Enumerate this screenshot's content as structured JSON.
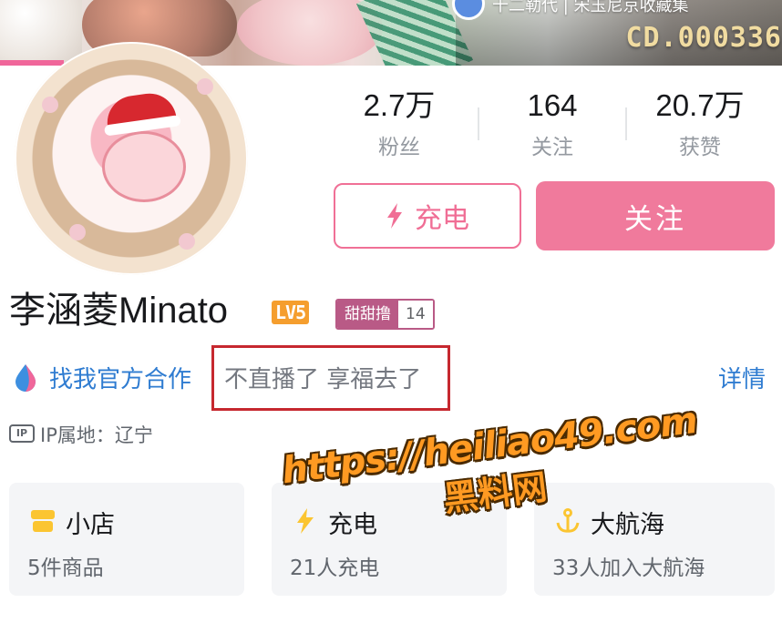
{
  "banner": {
    "tag_text": "十二勒代 | 宋玉尼京收藏集",
    "code_text": "CD.000336"
  },
  "stats": [
    {
      "value": "2.7万",
      "label": "粉丝"
    },
    {
      "value": "164",
      "label": "关注"
    },
    {
      "value": "20.7万",
      "label": "获赞"
    }
  ],
  "actions": {
    "charge_label": "充电",
    "follow_label": "关注"
  },
  "profile": {
    "username": "李涵菱Minato",
    "level_badge": "LV5",
    "medal_name": "甜甜撸",
    "medal_level": "14"
  },
  "bio": {
    "link_text": "找我官方合作",
    "text": "不直播了 享福去了",
    "detail_label": "详情"
  },
  "ip": {
    "icon_text": "IP",
    "text": "IP属地：辽宁"
  },
  "cards": [
    {
      "title": "小店",
      "subtitle": "5件商品"
    },
    {
      "title": "充电",
      "subtitle": "21人充电"
    },
    {
      "title": "大航海",
      "subtitle": "33人加入大航海"
    }
  ],
  "watermark": {
    "url": "https://heiliao49.com",
    "name": "黑料网"
  },
  "colors": {
    "accent_pink": "#f07a9c",
    "link_blue": "#2f7cd1",
    "highlight_red": "#c6282f",
    "level_orange": "#f59e2e",
    "medal_purple": "#b95a86"
  },
  "icons": {
    "charge": "lightning-icon",
    "bio": "water-drop-icon",
    "ip": "ip-badge-icon",
    "shop": "shop-icon",
    "battery": "battery-icon",
    "anchor": "anchor-icon"
  }
}
